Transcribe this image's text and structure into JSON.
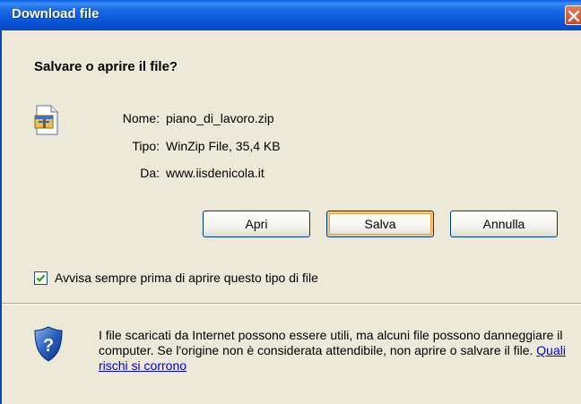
{
  "window": {
    "title": "Download file",
    "close_icon": "close-icon"
  },
  "dialog": {
    "heading": "Salvare o aprire il file?",
    "file_icon": "zip-file-icon",
    "fields": [
      {
        "label": "Nome:",
        "value": "piano_di_lavoro.zip"
      },
      {
        "label": "Tipo:",
        "value": "WinZip File, 35,4 KB"
      },
      {
        "label": "Da:",
        "value": "www.iisdenicola.it"
      }
    ],
    "buttons": {
      "open": "Apri",
      "save": "Salva",
      "cancel": "Annulla"
    },
    "checkbox": {
      "label": "Avvisa sempre prima di aprire questo tipo di file",
      "checked": true
    },
    "warning": {
      "icon": "security-shield-icon",
      "text": "I file scaricati da Internet possono essere utili, ma alcuni file possono danneggiare il computer. Se l'origine non è considerata attendibile, non aprire o salvare il file.",
      "link": "Quali rischi si corrono"
    }
  },
  "colors": {
    "titlebar": "#0a55d8",
    "dialog_bg": "#ece9d8",
    "link": "#0000ee"
  }
}
